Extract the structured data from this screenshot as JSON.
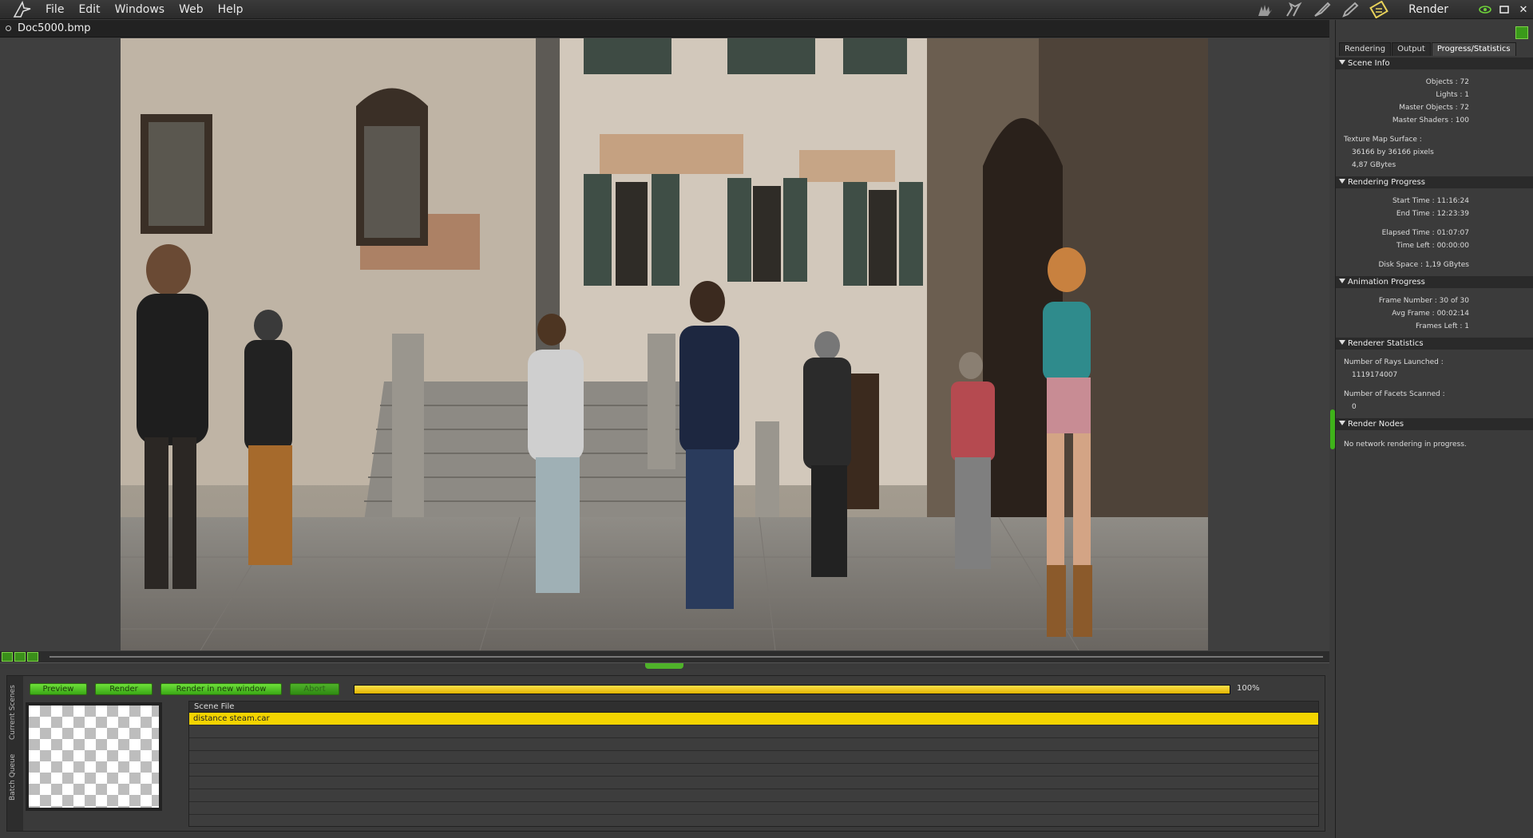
{
  "menubar": {
    "items": [
      "File",
      "Edit",
      "Windows",
      "Web",
      "Help"
    ],
    "room_label": "Render",
    "room_icons": [
      "hand-icon",
      "poser-tool-icon",
      "brush-icon",
      "pencil-icon",
      "render-room-icon"
    ],
    "window_controls": [
      "eye-icon",
      "maximize-icon",
      "close-icon"
    ]
  },
  "document": {
    "title": "Doc5000.bmp"
  },
  "queue": {
    "side_tabs": [
      "Current Scenes",
      "Batch Queue"
    ],
    "buttons": {
      "preview": "Preview",
      "render": "Render",
      "render_new": "Render in new window",
      "abort": "Abort"
    },
    "progress_percent": 100,
    "progress_text": "100%",
    "list_header": "Scene File",
    "rows": [
      "distance steam.car"
    ]
  },
  "right_panel": {
    "tabs": [
      "Rendering",
      "Output",
      "Progress/Statistics"
    ],
    "scene_info": {
      "header": "Scene Info",
      "objects": "Objects : 72",
      "lights": "Lights : 1",
      "master_objects": "Master Objects : 72",
      "master_shaders": "Master Shaders : 100",
      "texture_label": "Texture Map Surface :",
      "texture_size": "36166 by 36166 pixels",
      "texture_mem": "4,87 GBytes"
    },
    "rendering_progress": {
      "header": "Rendering Progress",
      "start": "Start Time : 11:16:24",
      "end": "End Time : 12:23:39",
      "elapsed": "Elapsed Time : 01:07:07",
      "left": "Time Left : 00:00:00",
      "disk": "Disk Space : 1,19 GBytes"
    },
    "animation_progress": {
      "header": "Animation Progress",
      "frame": "Frame Number : 30 of 30",
      "avg": "Avg Frame : 00:02:14",
      "frames_left": "Frames Left : 1"
    },
    "renderer_stats": {
      "header": "Renderer Statistics",
      "rays_label": "Number of Rays Launched :",
      "rays_value": "1119174007",
      "facets_label": "Number of Facets Scanned :",
      "facets_value": "0"
    },
    "render_nodes": {
      "header": "Render Nodes",
      "text": "No network rendering in progress."
    }
  },
  "colors": {
    "accent_green": "#4fb22a",
    "progress_yellow": "#f3d400"
  }
}
